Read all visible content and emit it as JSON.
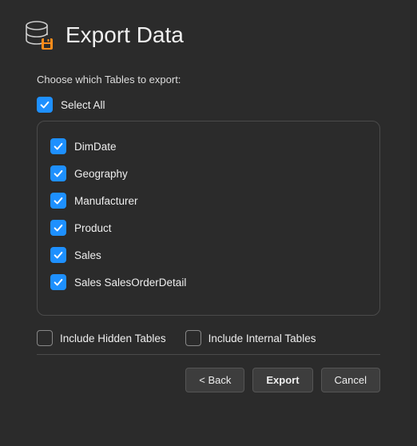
{
  "header": {
    "title": "Export Data"
  },
  "instruction": "Choose which Tables to export:",
  "selectAll": {
    "label": "Select All",
    "checked": true
  },
  "tables": [
    {
      "label": "DimDate",
      "checked": true
    },
    {
      "label": "Geography",
      "checked": true
    },
    {
      "label": "Manufacturer",
      "checked": true
    },
    {
      "label": "Product",
      "checked": true
    },
    {
      "label": "Sales",
      "checked": true
    },
    {
      "label": "Sales SalesOrderDetail",
      "checked": true
    }
  ],
  "options": {
    "includeHidden": {
      "label": "Include Hidden Tables",
      "checked": false
    },
    "includeInternal": {
      "label": "Include Internal Tables",
      "checked": false
    }
  },
  "buttons": {
    "back": "< Back",
    "export": "Export",
    "cancel": "Cancel"
  },
  "colors": {
    "accent": "#1e90ff",
    "saveAccent": "#ff8c1a"
  }
}
